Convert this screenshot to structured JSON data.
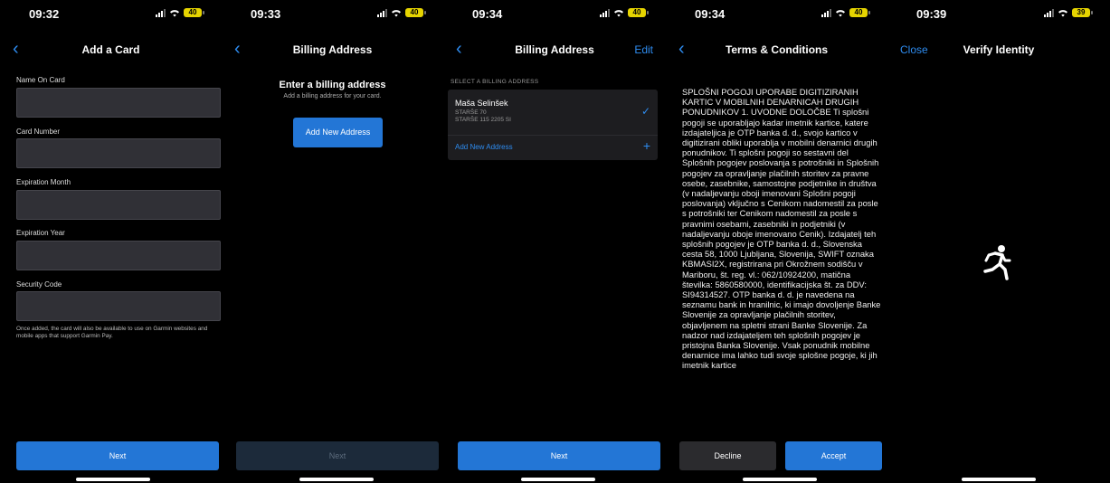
{
  "screens": [
    {
      "status": {
        "time": "09:32",
        "battery": "40"
      },
      "nav": {
        "title": "Add a Card",
        "back": "‹"
      },
      "fields": [
        {
          "label": "Name On Card",
          "value": ""
        },
        {
          "label": "Card Number",
          "value": ""
        },
        {
          "label": "Expiration Month",
          "value": ""
        },
        {
          "label": "Expiration Year",
          "value": ""
        },
        {
          "label": "Security Code",
          "value": ""
        }
      ],
      "footnote": "Once added, the card will also be available to use on Garmin websites and mobile apps that support Garmin Pay.",
      "button": "Next"
    },
    {
      "status": {
        "time": "09:33",
        "battery": "40"
      },
      "nav": {
        "title": "Billing Address",
        "back": "‹"
      },
      "heading": "Enter a billing address",
      "subheading": "Add a billing address for your card.",
      "add_button": "Add New Address",
      "button": "Next"
    },
    {
      "status": {
        "time": "09:34",
        "battery": "40"
      },
      "nav": {
        "title": "Billing Address",
        "back": "‹",
        "right": "Edit"
      },
      "section_label": "SELECT A BILLING ADDRESS",
      "address": {
        "name": "Maša Selinšek",
        "line1": "STARŠE 70",
        "line2": "STARŠE 115 2205 SI"
      },
      "add_address": "Add New Address",
      "button": "Next"
    },
    {
      "status": {
        "time": "09:34",
        "battery": "40"
      },
      "nav": {
        "title": "Terms & Conditions",
        "back": "‹"
      },
      "terms": "SPLOŠNI POGOJI UPORABE DIGITIZIRANIH KARTIC V MOBILNIH DENARNICAH DRUGIH PONUDNIKOV 1. UVODNE DOLOČBE Ti splošni pogoji se uporabljajo kadar imetnik kartice, katere izdajateljica je OTP banka d. d., svojo kartico v digitizirani obliki uporablja v mobilni denarnici drugih ponudnikov. Ti splošni pogoji so sestavni del Splošnih pogojev poslovanja s potrošniki in Splošnih pogojev za opravljanje plačilnih storitev za pravne osebe, zasebnike, samostojne podjetnike in društva (v nadaljevanju oboji imenovani Splošni pogoji poslovanja) vključno s Cenikom nadomestil za posle s potrošniki ter Cenikom nadomestil za posle s pravnimi osebami, zasebniki in podjetniki (v nadaljevanju oboje imenovano Cenik). Izdajatelj teh splošnih pogojev je OTP banka d. d., Slovenska cesta 58, 1000 Ljubljana, Slovenija, SWIFT oznaka KBMASI2X, registrirana pri Okrožnem sodišču v Mariboru, št. reg. vl.: 062/10924200, matična številka: 5860580000, identifikacijska št. za DDV: SI94314527. OTP banka d. d. je navedena na seznamu bank in hranilnic, ki imajo dovoljenje Banke Slovenije za opravljanje plačilnih storitev, objavljenem na spletni strani Banke Slovenije. Za nadzor nad izdajateljem teh splošnih pogojev je pristojna Banka Slovenije. Vsak ponudnik mobilne denarnice ima lahko tudi svoje splošne pogoje, ki jih imetnik kartice",
      "decline": "Decline",
      "accept": "Accept"
    },
    {
      "status": {
        "time": "09:39",
        "battery": "39"
      },
      "nav": {
        "title": "Verify Identity",
        "left": "Close"
      },
      "icon": "running-person-icon"
    }
  ],
  "colors": {
    "accent": "#2e8cf0",
    "button": "#2376d6",
    "background": "#000000"
  }
}
